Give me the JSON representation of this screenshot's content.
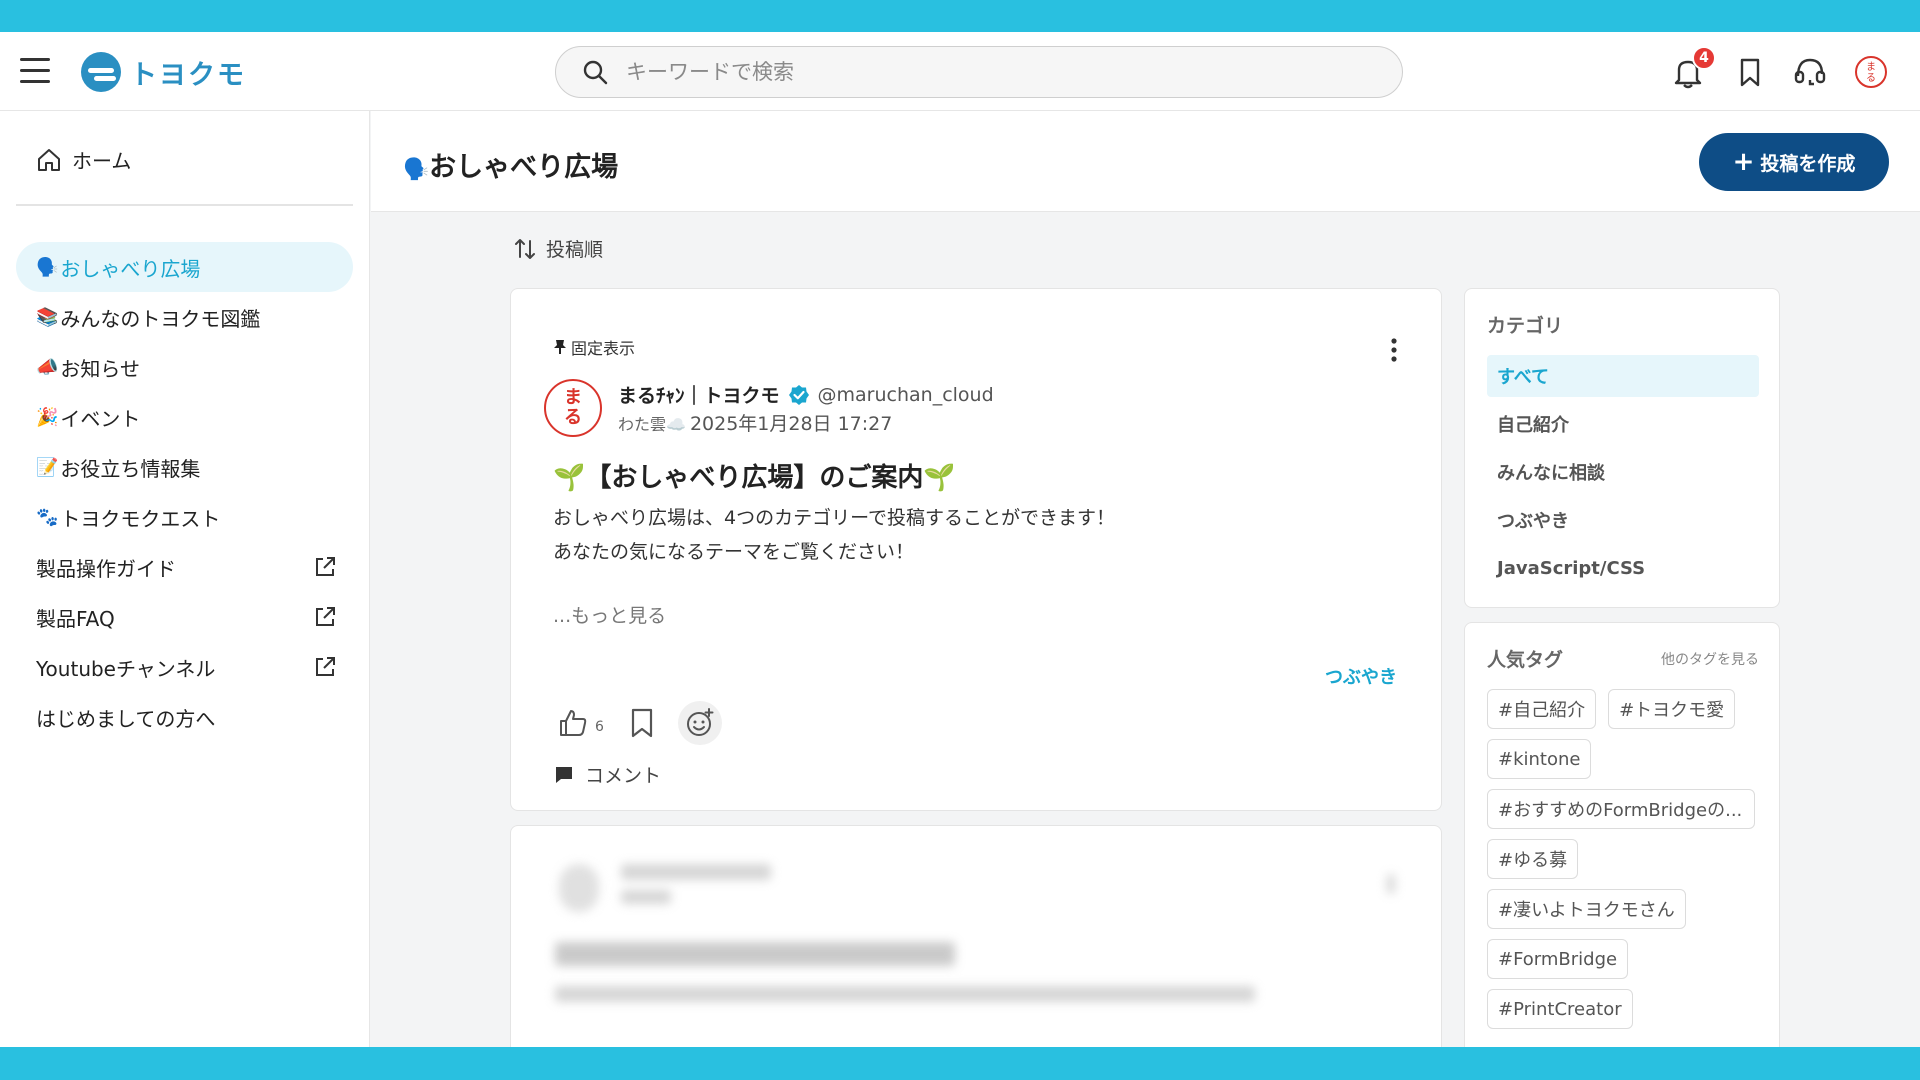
{
  "app": {
    "logo_text": "トヨクモ"
  },
  "header": {
    "search_placeholder": "キーワードで検索",
    "notification_count": "4"
  },
  "sidebar": {
    "home_label": "ホーム",
    "items": [
      {
        "emoji": "🗣️",
        "label": "おしゃべり広場"
      },
      {
        "emoji": "📚",
        "label": "みんなのトヨクモ図鑑"
      },
      {
        "emoji": "📣",
        "label": "お知らせ"
      },
      {
        "emoji": "🎉",
        "label": "イベント"
      },
      {
        "emoji": "📝",
        "label": "お役立ち情報集"
      },
      {
        "emoji": "🐾",
        "label": "トヨクモクエスト"
      }
    ],
    "links": [
      {
        "label": "製品操作ガイド"
      },
      {
        "label": "製品FAQ"
      },
      {
        "label": "Youtubeチャンネル"
      }
    ],
    "plain_link": "はじめましての方へ"
  },
  "main": {
    "title_emoji": "🗣️",
    "title": "おしゃべり広場",
    "create_label": "投稿を作成",
    "sort_label": "投稿順"
  },
  "post": {
    "pinned_label": "固定表示",
    "avatar_text_1": "ま",
    "avatar_text_2": "る",
    "author_name": "まるﾁｬﾝ｜トヨクモ",
    "handle": "@maruchan_cloud",
    "rank": "わた雲☁️",
    "date": "2025年1月28日 17:27",
    "title": "🌱【おしゃべり広場】のご案内🌱",
    "body_line1": "おしゃべり広場は、4つのカテゴリーで投稿することができます！",
    "body_line2": "あなたの気になるテーマをご覧ください！",
    "read_more": "...もっと見る",
    "category": "つぶやき",
    "like_count": "6",
    "comment_label": "コメント"
  },
  "categories": {
    "title": "カテゴリ",
    "items": [
      "すべて",
      "自己紹介",
      "みんなに相談",
      "つぶやき",
      "JavaScript/CSS"
    ]
  },
  "tags": {
    "title": "人気タグ",
    "more_label": "他のタグを見る",
    "items": [
      "#自己紹介",
      "#トヨクモ愛",
      "#kintone",
      "#おすすめのFormBridgeの...",
      "#ゆる募",
      "#凄いよトヨクモさん",
      "#FormBridge",
      "#PrintCreator"
    ]
  },
  "colors": {
    "accent": "#29c0e0",
    "primary": "#0e4d86",
    "active_text": "#1aa6cf"
  }
}
